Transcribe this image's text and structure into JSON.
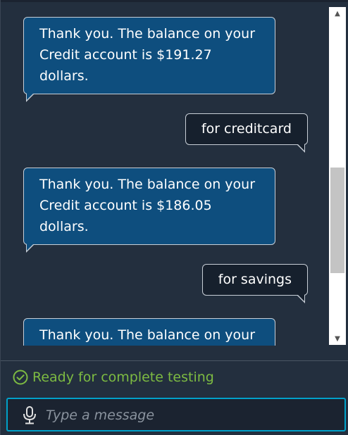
{
  "messages": [
    {
      "sender": "bot",
      "text": "Thank you. The balance on your Credit account is $191.27 dollars."
    },
    {
      "sender": "user",
      "text": "for creditcard"
    },
    {
      "sender": "bot",
      "text": "Thank you. The balance on your Credit account is $186.05 dollars."
    },
    {
      "sender": "user",
      "text": "for savings"
    },
    {
      "sender": "bot",
      "text": "Thank you. The balance on your"
    }
  ],
  "status": {
    "text": "Ready for complete testing",
    "icon": "check-circle-icon",
    "color": "#7dbb42"
  },
  "input": {
    "placeholder": "Type a message",
    "value": ""
  },
  "colors": {
    "bot_bubble": "#0e4e7e",
    "user_bubble": "#16202d",
    "background": "#232f3e",
    "input_focus_border": "#00a1c9"
  }
}
